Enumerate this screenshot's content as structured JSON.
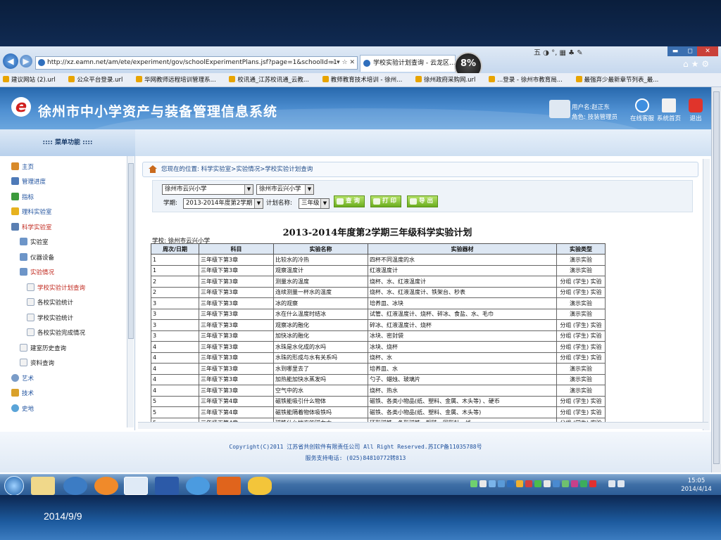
{
  "slide": {
    "date": "2014/9/9"
  },
  "browser": {
    "url": "http://xz.eamn.net/am/ete/experiment/gov/schoolExperimentPlans.jsf?page=1&schoolId=1",
    "url_tools": "⌕ ▾ ☆ ✕",
    "tab_title": "学校实验计划查询 - 云龙区...",
    "zoom": "8%",
    "ime": "五 ◑ °, ▦ ♣ ✎",
    "back_label": "◀",
    "forward_label": "▶",
    "min_label": "▬",
    "max_label": "◻",
    "close_label": "✕",
    "right_icons": "⌂★⚙",
    "favorites": [
      "建议网站 (2).url",
      "公众平台登录.url",
      "华网教师远程培训管理系...",
      "校讯通_江苏校讯通_云教...",
      "教师教育技术培训 - 徐州...",
      "徐州政府采购网.url",
      "...登录 - 徐州市教育局...",
      "最强弃少最新章节列表_最..."
    ]
  },
  "app": {
    "title": "徐州市中小学资产与装备管理信息系统",
    "logo_letter": "e",
    "user_name": "用户名:赵正东",
    "user_role": "角色: 技装管理员",
    "buttons": {
      "service": "在线客服",
      "home": "系统首页",
      "exit": "退出"
    }
  },
  "menu": {
    "header": "::::  菜单功能  ::::",
    "items": [
      {
        "label": "主页"
      },
      {
        "label": "管理进度"
      },
      {
        "label": "指标"
      },
      {
        "label": "理科实验室"
      },
      {
        "label": "科学实验室"
      },
      {
        "label": "实验室"
      },
      {
        "label": "仪器设备"
      },
      {
        "label": "实验情况"
      },
      {
        "label": "学校实验计划查询"
      },
      {
        "label": "各校实验统计"
      },
      {
        "label": "学校实验统计"
      },
      {
        "label": "各校实验完成情况"
      },
      {
        "label": "建室历史查询"
      },
      {
        "label": "资料查询"
      },
      {
        "label": "艺术"
      },
      {
        "label": "技术"
      },
      {
        "label": "史地"
      }
    ]
  },
  "breadcrumb": "您现在的位置: 科学实验室>实验情况>学校实验计划查询",
  "filters": {
    "district": "徐州市云兴小学",
    "school": "徐州市云兴小学",
    "term_label": "学期:",
    "term": "2013-2014年度第2学期",
    "plan_label": "计划名称:",
    "plan": "三年级",
    "query": "查 询",
    "print": "打 印",
    "export": "导 出",
    "dd_arrow": "▼"
  },
  "plan": {
    "title": "2013-2014年度第2学期三年级科学实验计划",
    "school": "学校: 徐州市云兴小学",
    "columns": [
      "周次/日期",
      "科目",
      "实验名称",
      "实验器材",
      "实验类型"
    ],
    "rows": [
      [
        "1",
        "三年级下第3章",
        "比较水的冷热",
        "四杯不同温度的水",
        "演示实验"
      ],
      [
        "1",
        "三年级下第3章",
        "观察温度计",
        "红液温度计",
        "演示实验"
      ],
      [
        "2",
        "三年级下第3章",
        "测量水的温度",
        "烧杯、水、红液温度计",
        "分组 (学生) 实验"
      ],
      [
        "2",
        "三年级下第3章",
        "连续测量一杯水的温度",
        "烧杯、水、红液温度计、铁架台、秒表",
        "分组 (学生) 实验"
      ],
      [
        "3",
        "三年级下第3章",
        "冰的观察",
        "培养皿、冰块",
        "演示实验"
      ],
      [
        "3",
        "三年级下第3章",
        "水在什么温度时结冰",
        "试管、红液温度计、烧杯、碎冰、食盐、水、毛巾",
        "演示实验"
      ],
      [
        "3",
        "三年级下第3章",
        "观察冰的融化",
        "碎冰、红液温度计、烧杯",
        "分组 (学生) 实验"
      ],
      [
        "3",
        "三年级下第3章",
        "加快冰的融化",
        "冰块、密封袋",
        "分组 (学生) 实验"
      ],
      [
        "4",
        "三年级下第3章",
        "水珠是水化成的水吗",
        "冰块、烧杯",
        "分组 (学生) 实验"
      ],
      [
        "4",
        "三年级下第3章",
        "水珠的形成与水有关系吗",
        "烧杯、水",
        "分组 (学生) 实验"
      ],
      [
        "4",
        "三年级下第3章",
        "水到哪里去了",
        "培养皿、水",
        "演示实验"
      ],
      [
        "4",
        "三年级下第3章",
        "加热能加快水蒸发吗",
        "勺子、蜡烛、玻璃片",
        "演示实验"
      ],
      [
        "4",
        "三年级下第3章",
        "空气中的水",
        "烧杯、热水",
        "演示实验"
      ],
      [
        "5",
        "三年级下第4章",
        "磁铁能吸引什么物体",
        "磁铁、各类小物品(纸、塑料、金属、木头等) 、硬币",
        "分组 (学生) 实验"
      ],
      [
        "5",
        "三年级下第4章",
        "磁铁能隔着物体吸铁吗",
        "磁铁、各类小物品(纸、塑料、金属、木头等)",
        "分组 (学生) 实验"
      ],
      [
        "5",
        "三年级下第4章",
        "磁铁什么地方的磁力大",
        "环形磁铁、条形磁铁、铜珠、回形针、线",
        "分组 (学生) 实验"
      ]
    ]
  },
  "footer": {
    "line1": "Copyright(C)2011 江苏省共创软件有限责任公司 All Right Reserved.苏ICP备11035788号",
    "line2": "服务支持电话: (025)84810772转813"
  },
  "taskbar": {
    "time": "15:05",
    "date": "2014/4/14"
  }
}
